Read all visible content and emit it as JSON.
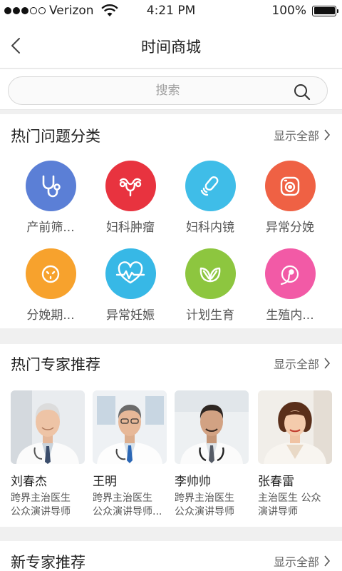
{
  "status_bar": {
    "carrier": "Verizon",
    "time": "4:21 PM",
    "battery": "100%"
  },
  "nav": {
    "title": "时间商城"
  },
  "search": {
    "placeholder": "搜索"
  },
  "hot_categories": {
    "title": "热门问题分类",
    "show_all": "显示全部",
    "items": [
      {
        "label": "产前筛...",
        "color": "#5b7fd6",
        "icon": "stethoscope-icon"
      },
      {
        "label": "妇科肿瘤",
        "color": "#e8333f",
        "icon": "uterus-icon"
      },
      {
        "label": "妇科内镜",
        "color": "#3fbde8",
        "icon": "endoscope-icon"
      },
      {
        "label": "异常分娩",
        "color": "#ef6144",
        "icon": "baby-monitor-icon"
      },
      {
        "label": "分娩期...",
        "color": "#f7a22d",
        "icon": "belly-icon"
      },
      {
        "label": "异常妊娠",
        "color": "#37b8e6",
        "icon": "heartbeat-icon"
      },
      {
        "label": "计划生育",
        "color": "#8dc63f",
        "icon": "leaf-icon"
      },
      {
        "label": "生殖内...",
        "color": "#f25aa6",
        "icon": "sperm-egg-icon"
      }
    ]
  },
  "hot_experts": {
    "title": "热门专家推荐",
    "show_all": "显示全部",
    "items": [
      {
        "name": "刘春杰",
        "desc1": "跨界主治医生",
        "desc2": "公众演讲导师"
      },
      {
        "name": "王明",
        "desc1": "跨界主治医生",
        "desc2": "公众演讲导师..."
      },
      {
        "name": "李帅帅",
        "desc1": "跨界主治医生",
        "desc2": "公众演讲导师"
      },
      {
        "name": "张春雷",
        "desc1": "主治医生 公众",
        "desc2": "演讲导师"
      }
    ]
  },
  "new_experts": {
    "title": "新专家推荐",
    "show_all": "显示全部"
  }
}
